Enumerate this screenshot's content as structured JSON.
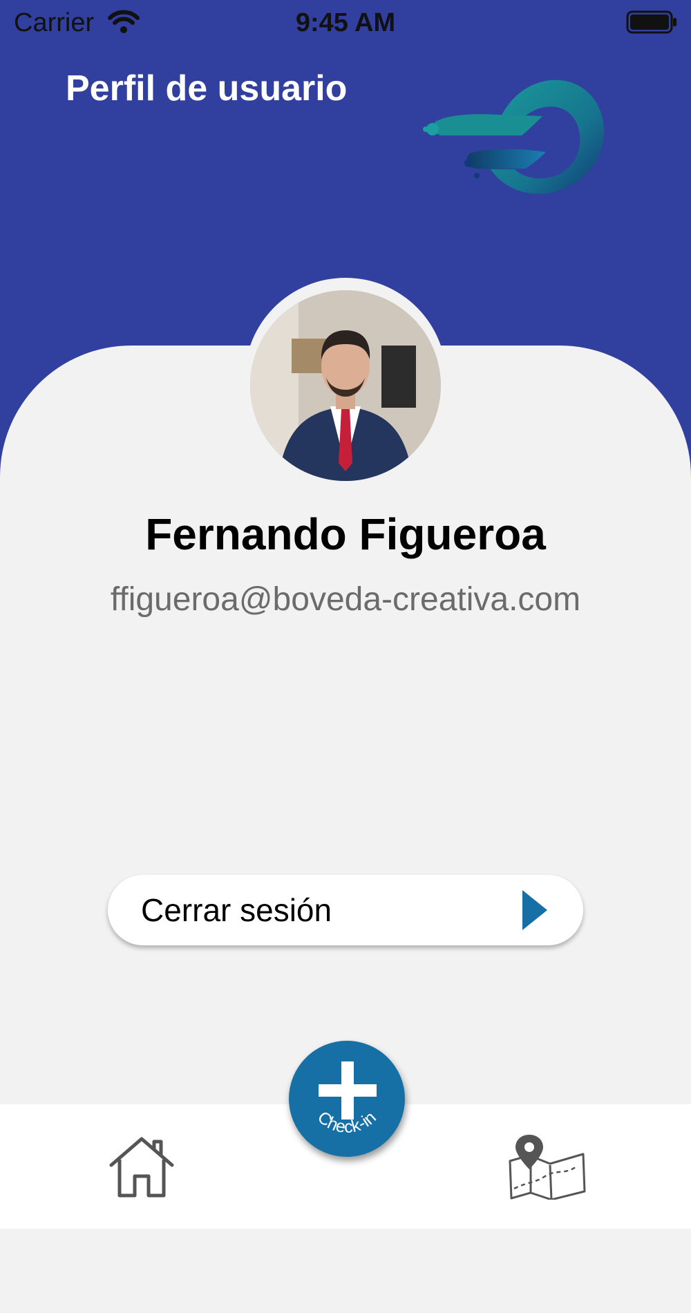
{
  "status_bar": {
    "carrier": "Carrier",
    "time": "9:45 AM",
    "icons": [
      "wifi-icon",
      "battery-icon"
    ]
  },
  "header": {
    "title": "Perfil de usuario",
    "background_color": "#313f9e",
    "logo": "brand-logo"
  },
  "profile": {
    "name": "Fernando Figueroa",
    "email": "ffigueroa@boveda-creativa.com",
    "avatar": "profile-photo"
  },
  "actions": {
    "logout_label": "Cerrar sesión",
    "logout_icon": "chevron-right-icon",
    "accent_color": "#1670a6"
  },
  "tab_bar": {
    "items": [
      {
        "icon": "home-icon"
      },
      {
        "icon": "plus-icon",
        "label": "Check-in"
      },
      {
        "icon": "map-icon"
      }
    ]
  }
}
